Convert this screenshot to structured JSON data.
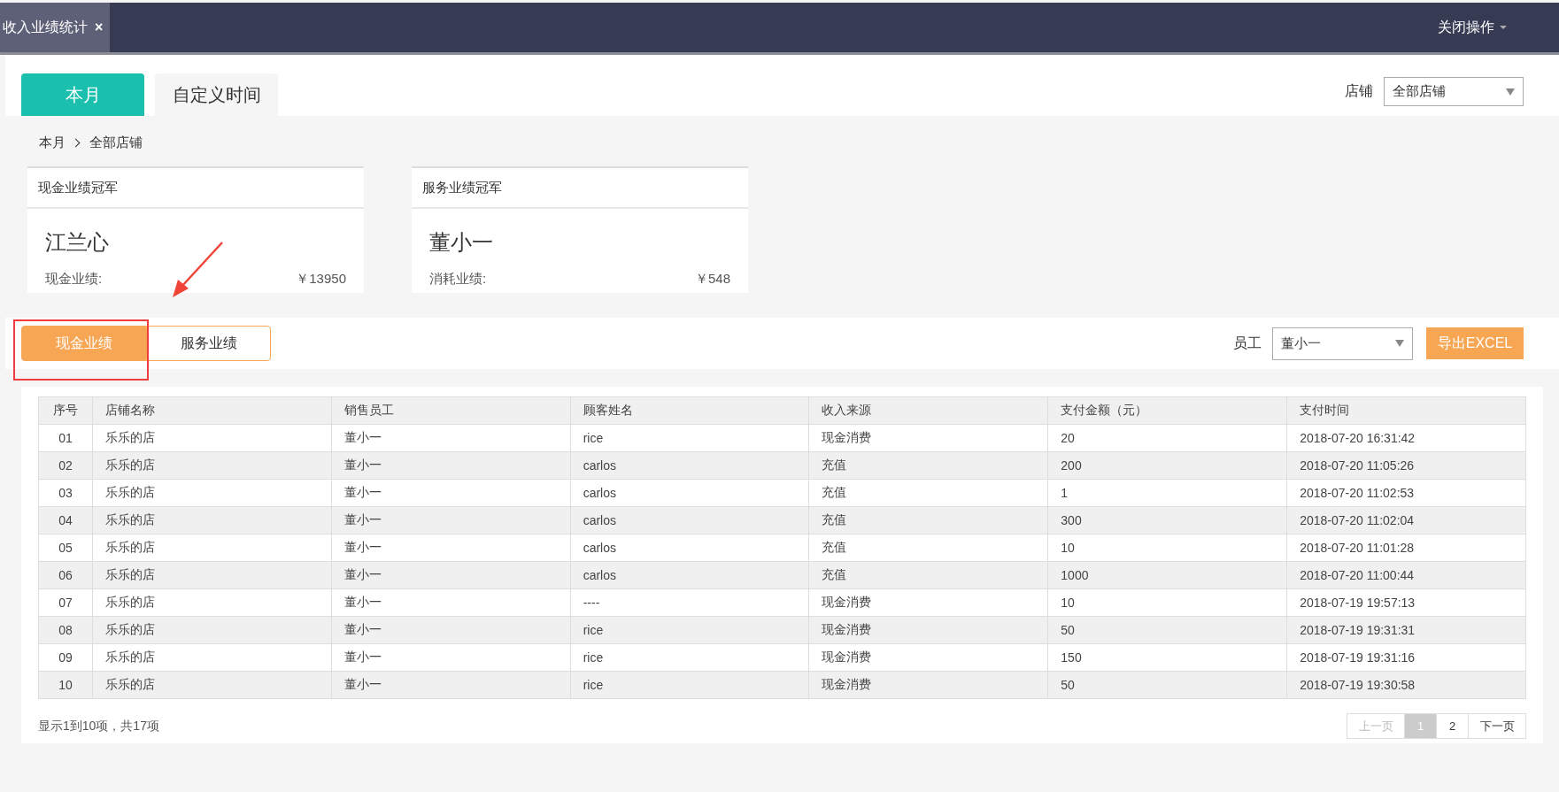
{
  "top_tab": {
    "title": "收入业绩统计",
    "close": "×"
  },
  "close_menu": {
    "label": "关闭操作"
  },
  "period_tabs": [
    {
      "label": "本月",
      "selected": true
    },
    {
      "label": "自定义时间",
      "selected": false
    }
  ],
  "store_filter": {
    "label": "店铺",
    "value": "全部店铺"
  },
  "breadcrumb": [
    "本月",
    "全部店铺"
  ],
  "cards": [
    {
      "title": "现金业绩冠军",
      "name": "江兰心",
      "metric": "现金业绩:",
      "amount": "￥13950"
    },
    {
      "title": "服务业绩冠军",
      "name": "董小一",
      "metric": "消耗业绩:",
      "amount": "￥548"
    }
  ],
  "type_tabs": [
    {
      "label": "现金业绩",
      "selected": true
    },
    {
      "label": "服务业绩",
      "selected": false
    }
  ],
  "staff_filter": {
    "label": "员工",
    "value": "董小一"
  },
  "export_button": "导出EXCEL",
  "table": {
    "columns": [
      "序号",
      "店铺名称",
      "销售员工",
      "顾客姓名",
      "收入来源",
      "支付金额（元）",
      "支付时间"
    ],
    "rows": [
      [
        "01",
        "乐乐的店",
        "董小一",
        "rice",
        "现金消费",
        "20",
        "2018-07-20 16:31:42"
      ],
      [
        "02",
        "乐乐的店",
        "董小一",
        "carlos",
        "充值",
        "200",
        "2018-07-20 11:05:26"
      ],
      [
        "03",
        "乐乐的店",
        "董小一",
        "carlos",
        "充值",
        "1",
        "2018-07-20 11:02:53"
      ],
      [
        "04",
        "乐乐的店",
        "董小一",
        "carlos",
        "充值",
        "300",
        "2018-07-20 11:02:04"
      ],
      [
        "05",
        "乐乐的店",
        "董小一",
        "carlos",
        "充值",
        "10",
        "2018-07-20 11:01:28"
      ],
      [
        "06",
        "乐乐的店",
        "董小一",
        "carlos",
        "充值",
        "1000",
        "2018-07-20 11:00:44"
      ],
      [
        "07",
        "乐乐的店",
        "董小一",
        "----",
        "现金消费",
        "10",
        "2018-07-19 19:57:13"
      ],
      [
        "08",
        "乐乐的店",
        "董小一",
        "rice",
        "现金消费",
        "50",
        "2018-07-19 19:31:31"
      ],
      [
        "09",
        "乐乐的店",
        "董小一",
        "rice",
        "现金消费",
        "150",
        "2018-07-19 19:31:16"
      ],
      [
        "10",
        "乐乐的店",
        "董小一",
        "rice",
        "现金消费",
        "50",
        "2018-07-19 19:30:58"
      ]
    ]
  },
  "summary": "显示1到10项，共17项",
  "pagination": [
    {
      "label": "上一页",
      "kind": "prev",
      "disabled": true,
      "selected": false
    },
    {
      "label": "1",
      "kind": "page",
      "disabled": false,
      "selected": true
    },
    {
      "label": "2",
      "kind": "page",
      "disabled": false,
      "selected": false
    },
    {
      "label": "下一页",
      "kind": "next",
      "disabled": false,
      "selected": false
    }
  ]
}
